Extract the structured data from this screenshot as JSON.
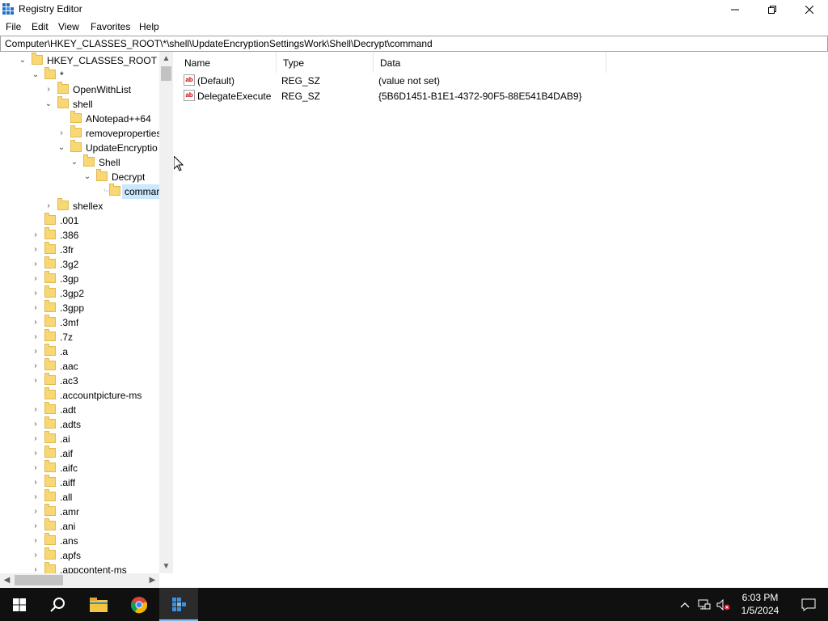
{
  "window": {
    "title": "Registry Editor",
    "controls": {
      "minimize": "minimize-icon",
      "restore": "restore-icon",
      "close": "close-icon"
    }
  },
  "menu": {
    "items": [
      "File",
      "Edit",
      "View",
      "Favorites",
      "Help"
    ]
  },
  "address": {
    "path": "Computer\\HKEY_CLASSES_ROOT\\*\\shell\\UpdateEncryptionSettingsWork\\Shell\\Decrypt\\command"
  },
  "tree": {
    "rows": [
      {
        "label": "HKEY_CLASSES_ROOT",
        "expander": "open"
      },
      {
        "label": "*",
        "expander": "open"
      },
      {
        "label": "OpenWithList",
        "expander": "closed"
      },
      {
        "label": "shell",
        "expander": "open"
      },
      {
        "label": "ANotepad++64",
        "expander": "none"
      },
      {
        "label": "removeproperties",
        "expander": "closed"
      },
      {
        "label": "UpdateEncryptio",
        "expander": "open"
      },
      {
        "label": "Shell",
        "expander": "open"
      },
      {
        "label": "Decrypt",
        "expander": "open"
      },
      {
        "label": "commar",
        "expander": "none",
        "selected": true
      },
      {
        "label": "shellex",
        "expander": "closed"
      },
      {
        "label": ".001",
        "expander": "none"
      },
      {
        "label": ".386",
        "expander": "closed"
      },
      {
        "label": ".3fr",
        "expander": "closed"
      },
      {
        "label": ".3g2",
        "expander": "closed"
      },
      {
        "label": ".3gp",
        "expander": "closed"
      },
      {
        "label": ".3gp2",
        "expander": "closed"
      },
      {
        "label": ".3gpp",
        "expander": "closed"
      },
      {
        "label": ".3mf",
        "expander": "closed"
      },
      {
        "label": ".7z",
        "expander": "closed"
      },
      {
        "label": ".a",
        "expander": "closed"
      },
      {
        "label": ".aac",
        "expander": "closed"
      },
      {
        "label": ".ac3",
        "expander": "closed"
      },
      {
        "label": ".accountpicture-ms",
        "expander": "none"
      },
      {
        "label": ".adt",
        "expander": "closed"
      },
      {
        "label": ".adts",
        "expander": "closed"
      },
      {
        "label": ".ai",
        "expander": "closed"
      },
      {
        "label": ".aif",
        "expander": "closed"
      },
      {
        "label": ".aifc",
        "expander": "closed"
      },
      {
        "label": ".aiff",
        "expander": "closed"
      },
      {
        "label": ".all",
        "expander": "closed"
      },
      {
        "label": ".amr",
        "expander": "closed"
      },
      {
        "label": ".ani",
        "expander": "closed"
      },
      {
        "label": ".ans",
        "expander": "closed"
      },
      {
        "label": ".apfs",
        "expander": "closed"
      },
      {
        "label": ".appcontent-ms",
        "expander": "closed"
      }
    ]
  },
  "values": {
    "columns": [
      "Name",
      "Type",
      "Data"
    ],
    "rows": [
      {
        "name": "(Default)",
        "type": "REG_SZ",
        "data": "(value not set)",
        "icon": "string-value-icon"
      },
      {
        "name": "DelegateExecute",
        "type": "REG_SZ",
        "data": "{5B6D1451-B1E1-4372-90F5-88E541B4DAB9}",
        "icon": "string-value-icon"
      }
    ]
  },
  "taskbar": {
    "time": "6:03 PM",
    "date": "1/5/2024",
    "icons": [
      "windows-start-icon",
      "search-icon",
      "file-explorer-icon",
      "chrome-icon",
      "regedit-icon"
    ],
    "tray_icons": [
      "chevron-up-icon",
      "network-icon",
      "volume-muted-icon",
      "notification-icon"
    ]
  },
  "colors": {
    "selection": "#cce8ff",
    "taskbar": "#101010",
    "folder": "#f8d775"
  }
}
